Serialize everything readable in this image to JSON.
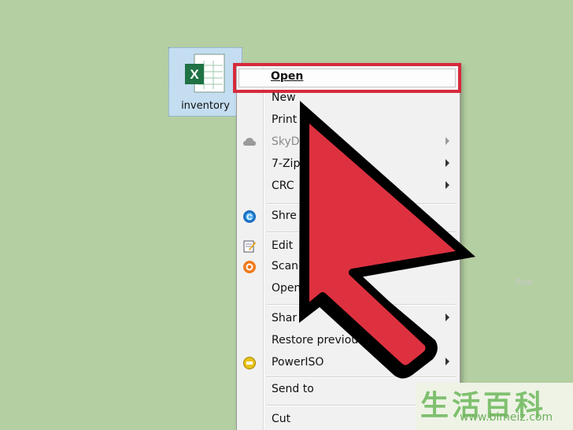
{
  "desktop_icon": {
    "label": "inventory",
    "file_letter": "X"
  },
  "menu": {
    "open_label": "Open",
    "items": [
      {
        "label": "New",
        "icon": "",
        "submenu": false,
        "disabled": false
      },
      {
        "label": "Print",
        "icon": "",
        "submenu": false,
        "disabled": false
      },
      {
        "label": "SkyD",
        "icon": "cloud-icon",
        "submenu": true,
        "disabled": true
      },
      {
        "label": "7-Zip",
        "icon": "",
        "submenu": true,
        "disabled": false
      },
      {
        "label": "CRC",
        "icon": "",
        "submenu": true,
        "disabled": false
      },
      {
        "label": "Shre",
        "icon": "ccleaner-icon",
        "submenu": false,
        "disabled": false
      },
      {
        "label": "Edit",
        "icon": "notepad-edit-icon",
        "submenu": false,
        "disabled": false
      },
      {
        "label": "Scan",
        "icon": "avast-icon",
        "submenu": false,
        "disabled": false
      },
      {
        "label": "Open",
        "icon": "",
        "submenu": false,
        "disabled": false
      },
      {
        "label": "Shar",
        "icon": "",
        "submenu": true,
        "disabled": false
      },
      {
        "label": "Restore previous vers",
        "icon": "",
        "submenu": false,
        "disabled": false
      },
      {
        "label": "PowerISO",
        "icon": "poweriso-icon",
        "submenu": true,
        "disabled": false
      },
      {
        "label": "Send to",
        "icon": "",
        "submenu": true,
        "disabled": false
      },
      {
        "label": "Cut",
        "icon": "",
        "submenu": false,
        "disabled": false
      }
    ]
  },
  "watermark": {
    "chars": "生活百科",
    "url": "www.bimeiz.com"
  },
  "ghost_text": "Pow",
  "colors": {
    "highlight": "#d62a3c",
    "background": "#b4cfa2",
    "excel_green": "#1f7244"
  }
}
